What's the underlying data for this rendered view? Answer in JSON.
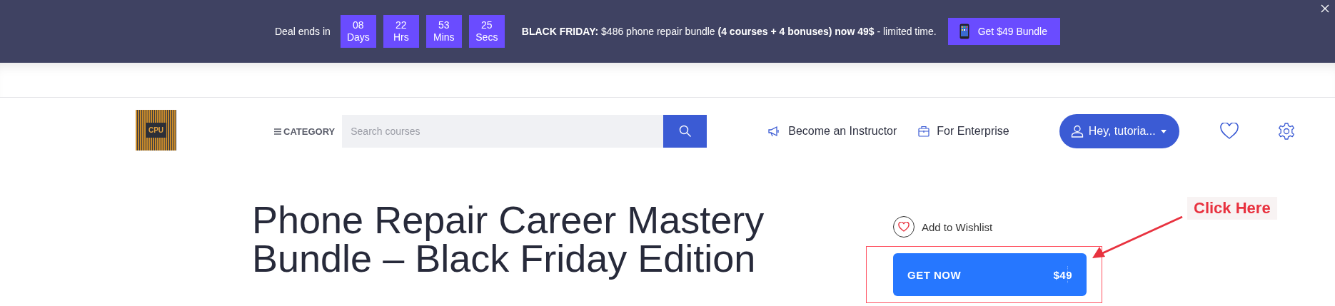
{
  "promo_bar": {
    "label": "Deal ends in",
    "countdown": [
      {
        "value": "08",
        "unit": "Days"
      },
      {
        "value": "22",
        "unit": "Hrs"
      },
      {
        "value": "53",
        "unit": "Mins"
      },
      {
        "value": "25",
        "unit": "Secs"
      }
    ],
    "message": "**BLACK FRIDAY:** $486 phone repair bundle **(4 courses + 4 bonuses) now 49$** - limited time.",
    "button": "Get $49 Bundle"
  },
  "header": {
    "logo_text": "CPU",
    "category": "CATEGORY",
    "search": {
      "placeholder": "Search courses"
    },
    "links": [
      "Become an Instructor",
      "For Enterprise"
    ],
    "user_button": "Hey, tutoria..."
  },
  "course": {
    "title": "Phone Repair Career Mastery Bundle – Black Friday Edition",
    "wishlist": "Add to Wishlist",
    "buy_button": {
      "label": "GET NOW",
      "price": "$49"
    }
  },
  "annotation": {
    "text": "Click Here"
  }
}
